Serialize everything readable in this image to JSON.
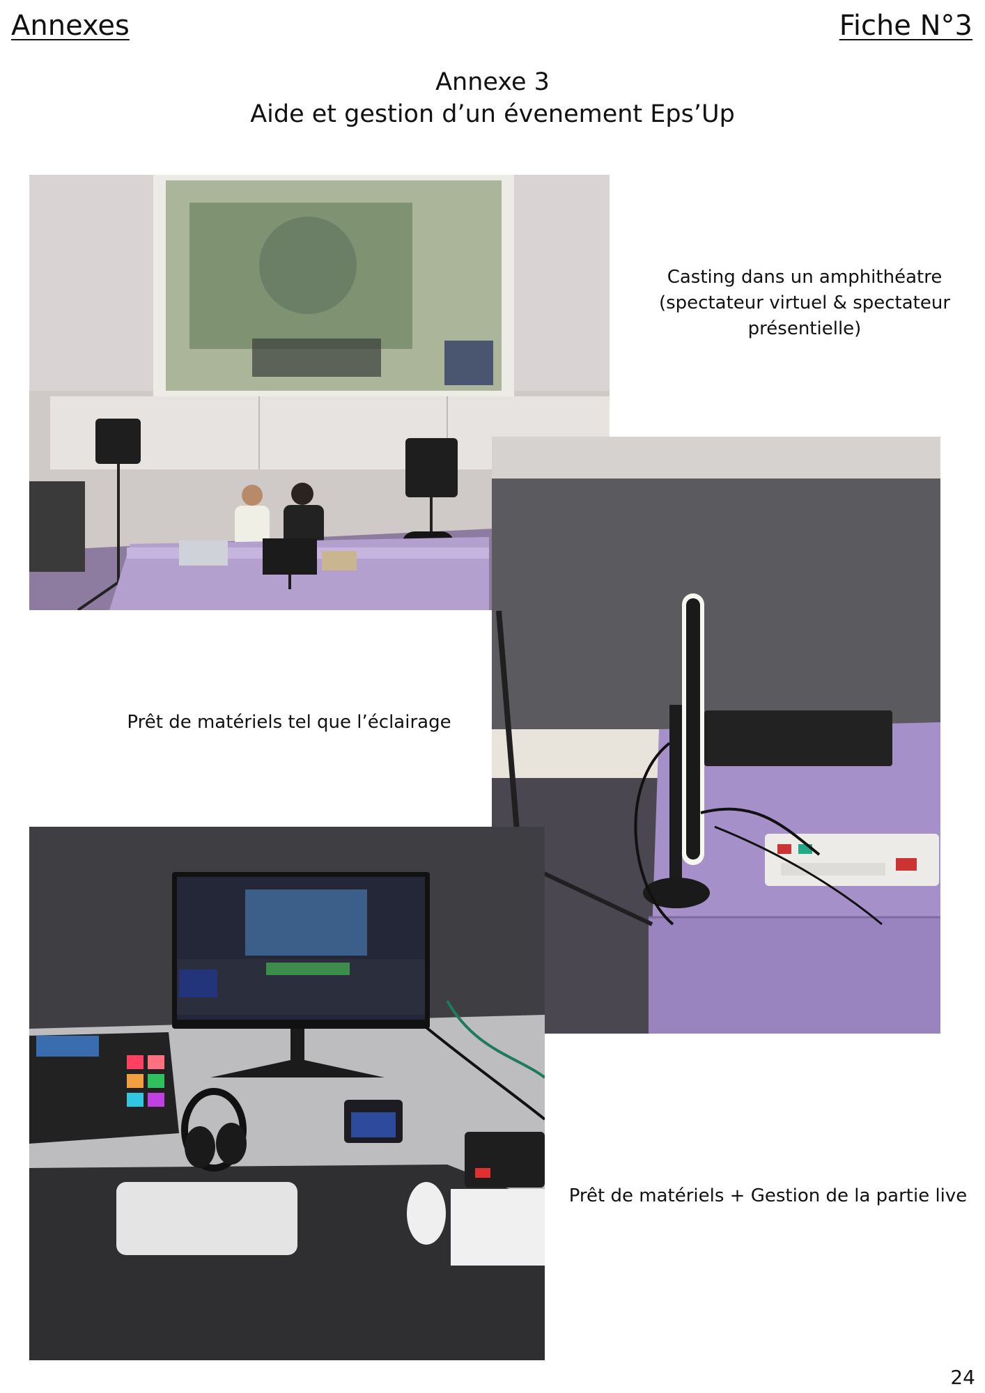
{
  "header": {
    "left": "Annexes",
    "right": "Fiche N°3"
  },
  "title": {
    "line1": "Annexe 3",
    "line2": "Aide et gestion d’un évenement Eps’Up"
  },
  "captions": {
    "casting": [
      "Casting dans un amphithéatre",
      "(spectateur virtuel & spectateur",
      "présentielle)"
    ],
    "lighting": "Prêt de matériels tel que l’éclairage",
    "live": "Prêt de matériels + Gestion de la partie live"
  },
  "page_number": "24"
}
